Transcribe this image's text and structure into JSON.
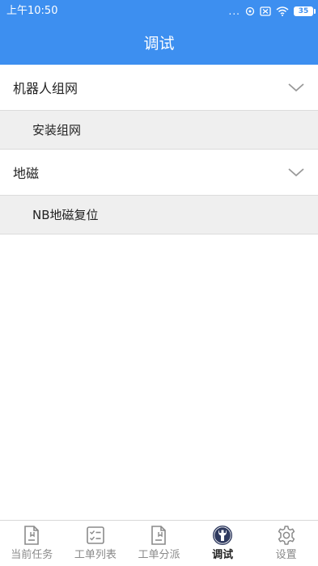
{
  "status_bar": {
    "time": "上午10:50",
    "dots": "...",
    "battery": "35"
  },
  "header": {
    "title": "调试"
  },
  "groups": [
    {
      "label": "机器人组网",
      "children": [
        {
          "label": "安装组网"
        }
      ]
    },
    {
      "label": "地磁",
      "children": [
        {
          "label": "NB地磁复位"
        }
      ]
    }
  ],
  "tab_bar": {
    "active_index": 3,
    "tabs": [
      {
        "label": "当前任务",
        "icon": "task-doc-icon"
      },
      {
        "label": "工单列表",
        "icon": "checklist-icon"
      },
      {
        "label": "工单分派",
        "icon": "dispatch-doc-icon"
      },
      {
        "label": "调试",
        "icon": "wrench-icon"
      },
      {
        "label": "设置",
        "icon": "gear-icon"
      }
    ]
  },
  "colors": {
    "primary": "#3d8ff0",
    "child_bg": "#efefef",
    "tab_inactive": "#8a8a8a",
    "tab_active": "#222222"
  }
}
